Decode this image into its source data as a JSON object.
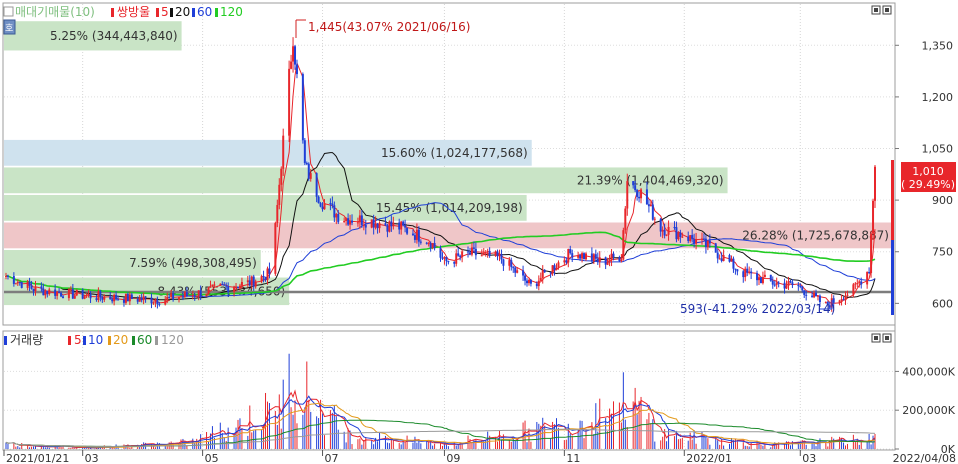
{
  "price_panel": {
    "legend": {
      "label_vp": "매대기매물(10)",
      "label_candle": "쌍방울",
      "ma_prefix_5": "5",
      "ma_prefix_20": "20",
      "ma_prefix_60": "60",
      "ma_prefix_120": "120"
    },
    "side_button": "호",
    "colors": {
      "up": "#e8262b",
      "down": "#1f3fd8",
      "ma5": "#e8262b",
      "ma20": "#111111",
      "ma60": "#1f3fd8",
      "ma120": "#22cc22",
      "vp_green": "#c9e4c6",
      "vp_blue": "#cfe2ee",
      "vp_red": "#efc6c8",
      "support_line": "#7d7d7d"
    },
    "high_annotation": "1,445(43.07% 2021/06/16)",
    "low_annotation": "593(-41.29% 2022/03/14)",
    "current_price": "1,010",
    "current_change": "( 29.49%)",
    "volume_profile": [
      {
        "label": "5.25% (344,443,840)",
        "kind": "green",
        "price_low": 1335,
        "price_high": 1420
      },
      {
        "label": "15.60% (1,024,177,568)",
        "kind": "blue",
        "price_low": 1000,
        "price_high": 1075
      },
      {
        "label": "21.39% (1,404,469,320)",
        "kind": "green",
        "price_low": 920,
        "price_high": 995
      },
      {
        "label": "15.45% (1,014,209,198)",
        "kind": "green",
        "price_low": 840,
        "price_high": 915
      },
      {
        "label": "26.28% (1,725,678,887)",
        "kind": "red",
        "price_low": 760,
        "price_high": 835
      },
      {
        "label": "7.59% (498,308,495)",
        "kind": "green",
        "price_low": 680,
        "price_high": 755
      },
      {
        "label": "8.43% (553,734,650)",
        "kind": "green",
        "price_low": 595,
        "price_high": 675
      }
    ],
    "support_price": 633
  },
  "volume_panel": {
    "legend": {
      "label": "거래량",
      "ma5": "5",
      "ma10": "10",
      "ma20": "20",
      "ma60": "60",
      "ma120": "120"
    },
    "colors": {
      "ma5": "#e8262b",
      "ma10": "#1f3fd8",
      "ma20": "#e39a1b",
      "ma60": "#1a8a2a",
      "ma120": "#9a9a9a"
    }
  },
  "x_axis_labels": [
    "2021/01/21",
    "03",
    "05",
    "07",
    "09",
    "11",
    "2022/01",
    "03",
    "2022/04/08"
  ],
  "chart_data": {
    "type": "candlestick",
    "title": "쌍방울",
    "x_range": [
      "2021/01/21",
      "2022/04/08"
    ],
    "price_axis": {
      "ticks": [
        600,
        750,
        900,
        1050,
        1200,
        1350
      ],
      "ylim": [
        540,
        1470
      ]
    },
    "volume_axis": {
      "ticks": [
        "0K",
        "200,000K",
        "400,000K"
      ],
      "ylim": [
        0,
        500000
      ]
    },
    "price_path": [
      {
        "date": "2021/01/21",
        "close": 680
      },
      {
        "date": "2021/02/05",
        "close": 640
      },
      {
        "date": "2021/02/25",
        "close": 625
      },
      {
        "date": "2021/03/20",
        "close": 615
      },
      {
        "date": "2021/04/10",
        "close": 610
      },
      {
        "date": "2021/04/25",
        "close": 625
      },
      {
        "date": "2021/05/10",
        "close": 645
      },
      {
        "date": "2021/05/25",
        "close": 660
      },
      {
        "date": "2021/06/05",
        "close": 690
      },
      {
        "date": "2021/06/10",
        "close": 1010
      },
      {
        "date": "2021/06/16",
        "close": 1380
      },
      {
        "date": "2021/06/22",
        "close": 1000
      },
      {
        "date": "2021/06/30",
        "close": 900
      },
      {
        "date": "2021/07/10",
        "close": 850
      },
      {
        "date": "2021/07/25",
        "close": 840
      },
      {
        "date": "2021/08/10",
        "close": 820
      },
      {
        "date": "2021/08/25",
        "close": 780
      },
      {
        "date": "2021/09/01",
        "close": 720
      },
      {
        "date": "2021/09/15",
        "close": 745
      },
      {
        "date": "2021/09/30",
        "close": 730
      },
      {
        "date": "2021/10/15",
        "close": 650
      },
      {
        "date": "2021/10/25",
        "close": 700
      },
      {
        "date": "2021/11/05",
        "close": 750
      },
      {
        "date": "2021/11/20",
        "close": 720
      },
      {
        "date": "2021/11/30",
        "close": 740
      },
      {
        "date": "2021/12/03",
        "close": 960
      },
      {
        "date": "2021/12/10",
        "close": 920
      },
      {
        "date": "2021/12/20",
        "close": 820
      },
      {
        "date": "2021/12/31",
        "close": 800
      },
      {
        "date": "2022/01/15",
        "close": 760
      },
      {
        "date": "2022/01/30",
        "close": 690
      },
      {
        "date": "2022/02/15",
        "close": 660
      },
      {
        "date": "2022/02/28",
        "close": 650
      },
      {
        "date": "2022/03/14",
        "close": 593
      },
      {
        "date": "2022/03/28",
        "close": 640
      },
      {
        "date": "2022/04/05",
        "close": 700
      },
      {
        "date": "2022/04/08",
        "close": 1010
      }
    ],
    "high": {
      "price": 1445,
      "date": "2021/06/16",
      "change_pct": 43.07
    },
    "low": {
      "price": 593,
      "date": "2022/03/14",
      "change_pct": -41.29
    },
    "last": {
      "price": 1010,
      "change_pct": 29.49
    },
    "volume_path": [
      {
        "date": "2021/01/21",
        "volume": 30000
      },
      {
        "date": "2021/03/01",
        "volume": 8000
      },
      {
        "date": "2021/04/25",
        "volume": 40000
      },
      {
        "date": "2021/06/10",
        "volume": 250000
      },
      {
        "date": "2021/06/16",
        "volume": 480000
      },
      {
        "date": "2021/06/25",
        "volume": 300000
      },
      {
        "date": "2021/07/15",
        "volume": 80000
      },
      {
        "date": "2021/09/01",
        "volume": 30000
      },
      {
        "date": "2021/11/05",
        "volume": 150000
      },
      {
        "date": "2021/12/03",
        "volume": 300000
      },
      {
        "date": "2021/12/20",
        "volume": 90000
      },
      {
        "date": "2022/02/15",
        "volume": 25000
      },
      {
        "date": "2022/04/08",
        "volume": 60000
      }
    ]
  }
}
